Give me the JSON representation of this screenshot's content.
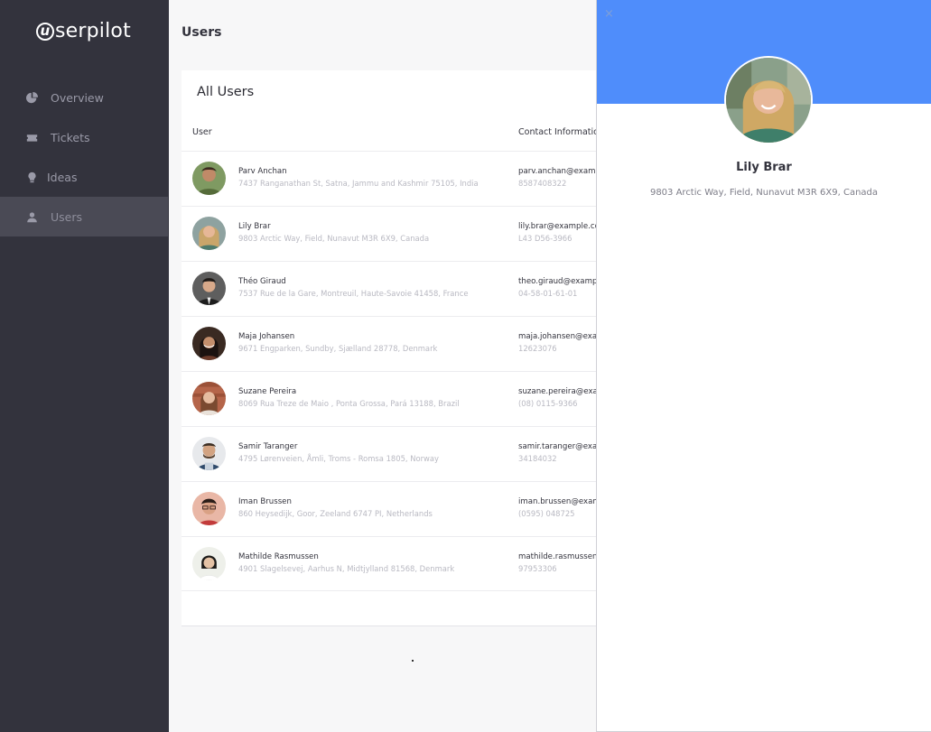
{
  "app": {
    "logo_rest": "serpilot",
    "logo_initial": "u"
  },
  "sidebar": {
    "items": [
      {
        "label": "Overview",
        "icon": "pie-chart-icon"
      },
      {
        "label": "Tickets",
        "icon": "ticket-icon"
      },
      {
        "label": "Ideas",
        "icon": "lightbulb-icon"
      },
      {
        "label": "Users",
        "icon": "user-icon",
        "active": true
      }
    ]
  },
  "page": {
    "title": "Users"
  },
  "card": {
    "title": "All Users",
    "columns": [
      "User",
      "Contact Information"
    ]
  },
  "users": [
    {
      "name": "Parv Anchan",
      "address": "7437 Ranganathan St, Satna, Jammu and Kashmir 75105, India",
      "email": "parv.anchan@example.com",
      "phone": "8587408322"
    },
    {
      "name": "Lily Brar",
      "address": "9803 Arctic Way, Field, Nunavut M3R 6X9, Canada",
      "email": "lily.brar@example.com",
      "phone": "L43 D56-3966"
    },
    {
      "name": "Théo Giraud",
      "address": "7537 Rue de la Gare, Montreuil, Haute-Savoie 41458, France",
      "email": "theo.giraud@example.com",
      "phone": "04-58-01-61-01"
    },
    {
      "name": "Maja Johansen",
      "address": "9671 Engparken, Sundby, Sjælland 28778, Denmark",
      "email": "maja.johansen@example.com",
      "phone": "12623076"
    },
    {
      "name": "Suzane Pereira",
      "address": "8069 Rua Treze de Maio , Ponta Grossa, Pará 13188, Brazil",
      "email": "suzane.pereira@example.com",
      "phone": "(08) 0115-9366"
    },
    {
      "name": "Samir Taranger",
      "address": "4795 Lørenveien, Åmli, Troms - Romsa 1805, Norway",
      "email": "samir.taranger@example.com",
      "phone": "34184032"
    },
    {
      "name": "Iman Brussen",
      "address": "860 Heysedijk, Goor, Zeeland 6747 PI, Netherlands",
      "email": "iman.brussen@example.com",
      "phone": "(0595) 048725"
    },
    {
      "name": "Mathilde Rasmussen",
      "address": "4901 Slagelsevej, Aarhus N, Midtjylland 81568, Denmark",
      "email": "mathilde.rasmussen@example.com",
      "phone": "97953306"
    }
  ],
  "drawer": {
    "close_label": "×",
    "name": "Lily Brar",
    "address": "9803 Arctic Way, Field, Nunavut M3R 6X9, Canada"
  },
  "colors": {
    "sidebar_bg": "#33333d",
    "accent_blue": "#4f8dfb",
    "active_item_bg": "#4a4a55"
  }
}
